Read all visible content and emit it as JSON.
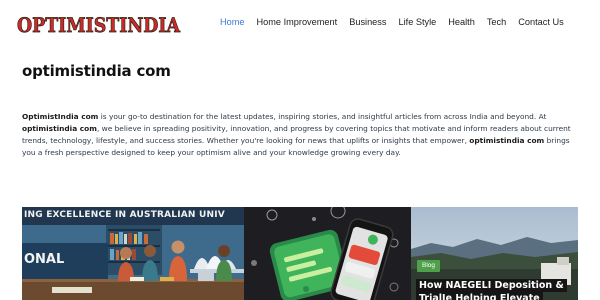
{
  "site": {
    "logo_text": "OPTIMISTINDIA"
  },
  "nav": {
    "items": [
      {
        "label": "Home",
        "active": true
      },
      {
        "label": "Home Improvement",
        "active": false
      },
      {
        "label": "Business",
        "active": false
      },
      {
        "label": "Life Style",
        "active": false
      },
      {
        "label": "Health",
        "active": false
      },
      {
        "label": "Tech",
        "active": false
      },
      {
        "label": "Contact Us",
        "active": false
      }
    ],
    "active_color": "#3a7bd5"
  },
  "main": {
    "title": "optimistindia com",
    "intro": {
      "brand1": "OptimistIndia com",
      "text1": " is your go-to destination for the latest updates, inspiring stories, and insightful articles from across India and beyond. At ",
      "brand2": "optimistindia com",
      "text2": ", we believe in spreading positivity, innovation, and progress by covering topics that motivate and inform readers about current trends, technology, lifestyle, and success stories. Whether you're looking for news that uplifts or insights that empower, ",
      "brand3": "optimistindia com",
      "text3": " brings you a fresh perspective designed to keep your optimism alive and your knowledge growing every day."
    }
  },
  "cards": [
    {
      "image_banner_text": "ING EXCELLENCE IN AUSTRALIAN UNIV",
      "image_side_text": "ONAL",
      "icon": "students-studying-illustration"
    },
    {
      "icon": "smartphone-app-illustration"
    },
    {
      "category": "Blog",
      "title": "How NAEGELI Deposition & TrialJe Helping Elevate",
      "icon": "landscape-photo",
      "badge_color": "#4ea14a"
    }
  ]
}
